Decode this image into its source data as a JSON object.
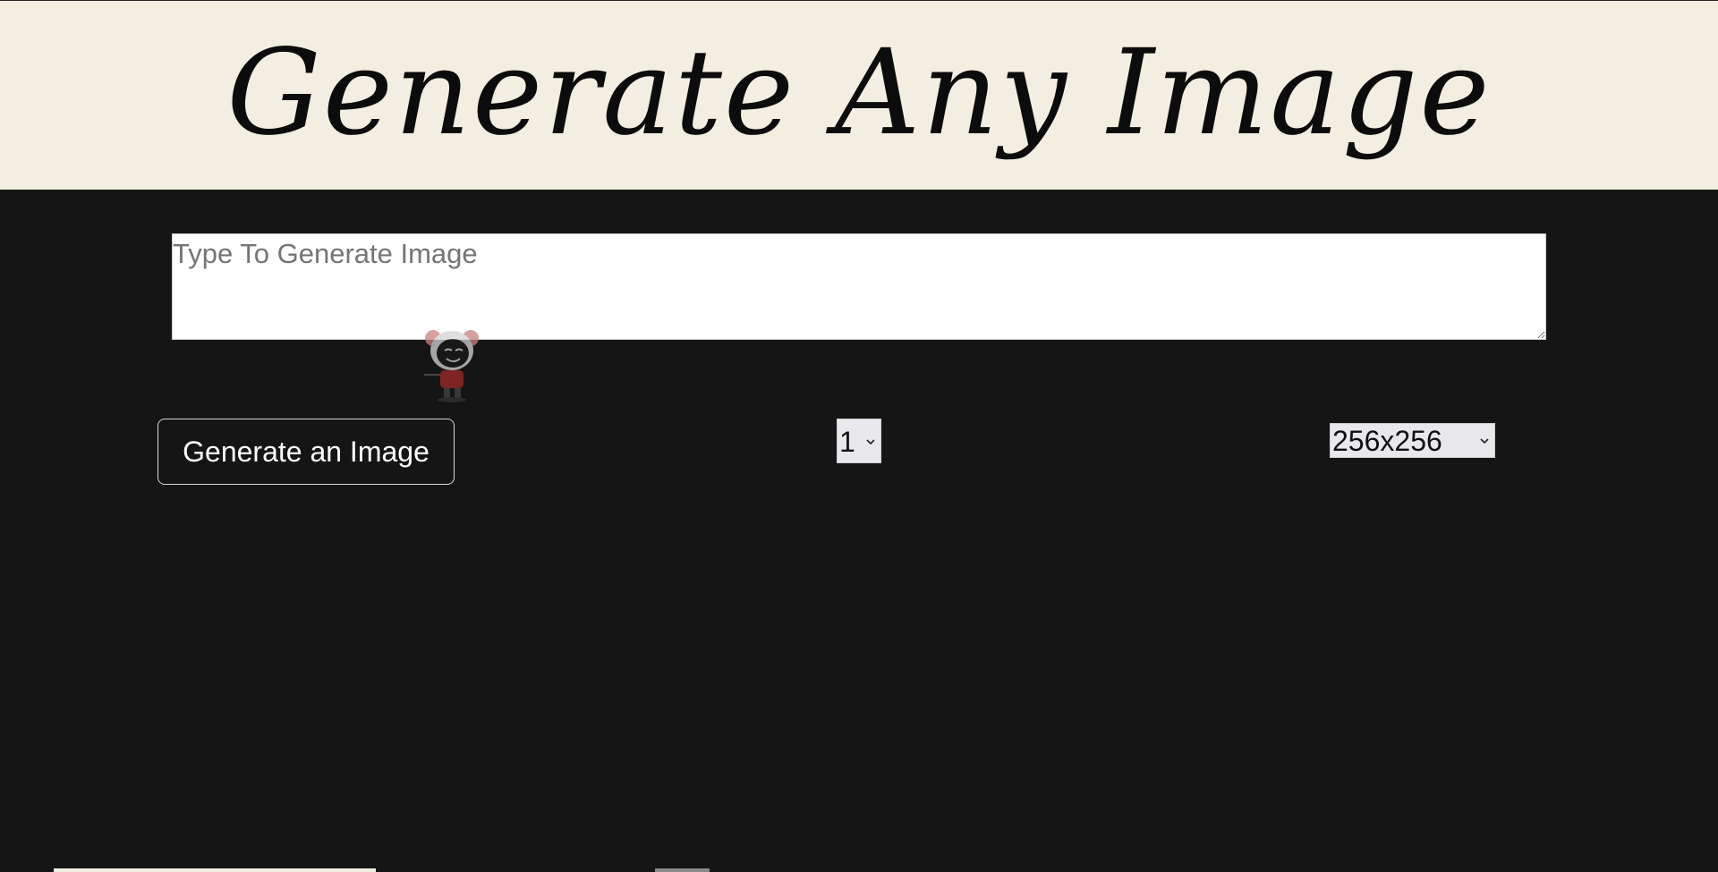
{
  "header": {
    "title": "Generate Any Image",
    "background_color": "#f2eee1"
  },
  "prompt": {
    "placeholder": "Type To Generate Image",
    "value": ""
  },
  "controls": {
    "generate_label": "Generate an Image",
    "count_value": "1",
    "size_value": "256x256"
  },
  "icons": {
    "mascot": "robot-cat-mascot-icon",
    "select_arrow": "chevron-down-icon"
  },
  "colors": {
    "page_background": "#151515",
    "button_border": "#d9d9d9"
  }
}
